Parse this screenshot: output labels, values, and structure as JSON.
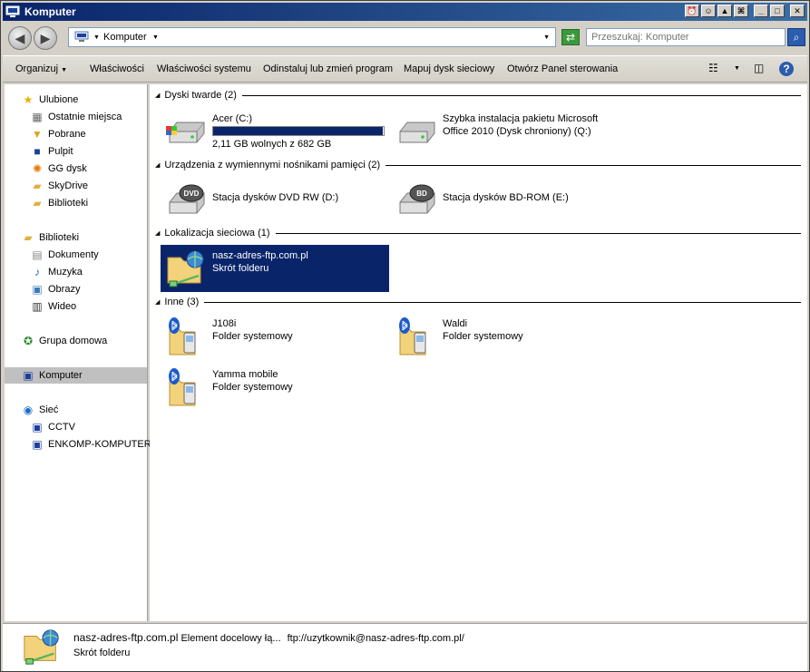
{
  "window": {
    "title": "Komputer"
  },
  "address": {
    "location": "Komputer"
  },
  "search": {
    "placeholder": "Przeszukaj: Komputer"
  },
  "toolbar": {
    "items": [
      "Organizuj",
      "Właściwości",
      "Właściwości systemu",
      "Odinstaluj lub zmień program",
      "Mapuj dysk sieciowy",
      "Otwórz Panel sterowania"
    ]
  },
  "sidebar": {
    "favorites": {
      "label": "Ulubione",
      "items": [
        "Ostatnie miejsca",
        "Pobrane",
        "Pulpit",
        "GG dysk",
        "SkyDrive",
        "Biblioteki"
      ]
    },
    "libraries": {
      "label": "Biblioteki",
      "items": [
        "Dokumenty",
        "Muzyka",
        "Obrazy",
        "Wideo"
      ]
    },
    "homegroup": "Grupa domowa",
    "computer": "Komputer",
    "network": {
      "label": "Sieć",
      "items": [
        "CCTV",
        "ENKOMP-KOMPUTER"
      ]
    }
  },
  "groups": {
    "hard_drives": {
      "label": "Dyski twarde (2)",
      "c_drive": {
        "name": "Acer (C:)",
        "free": "2,11 GB wolnych z 682 GB",
        "used_fraction": 0.997
      },
      "q_drive": {
        "line1": "Szybka instalacja pakietu Microsoft",
        "line2": "Office 2010 (Dysk chroniony) (Q:)"
      }
    },
    "removable": {
      "label": "Urządzenia z wymiennymi nośnikami pamięci (2)",
      "dvd": {
        "name": "Stacja dysków DVD RW (D:)",
        "badge": "DVD"
      },
      "bd": {
        "name": "Stacja dysków BD-ROM (E:)",
        "badge": "BD"
      }
    },
    "network": {
      "label": "Lokalizacja sieciowa (1)",
      "ftp": {
        "name": "nasz-adres-ftp.com.pl",
        "type": "Skrót folderu"
      }
    },
    "other": {
      "label": "Inne (3)",
      "items": [
        {
          "name": "J108i",
          "type": "Folder systemowy"
        },
        {
          "name": "Waldi",
          "type": "Folder systemowy"
        },
        {
          "name": "Yamma mobile",
          "type": "Folder systemowy"
        }
      ]
    }
  },
  "details": {
    "name": "nasz-adres-ftp.com.pl",
    "target_label": "Element docelowy łą...",
    "target_value": "ftp://uzytkownik@nasz-adres-ftp.com.pl/",
    "type": "Skrót folderu"
  }
}
